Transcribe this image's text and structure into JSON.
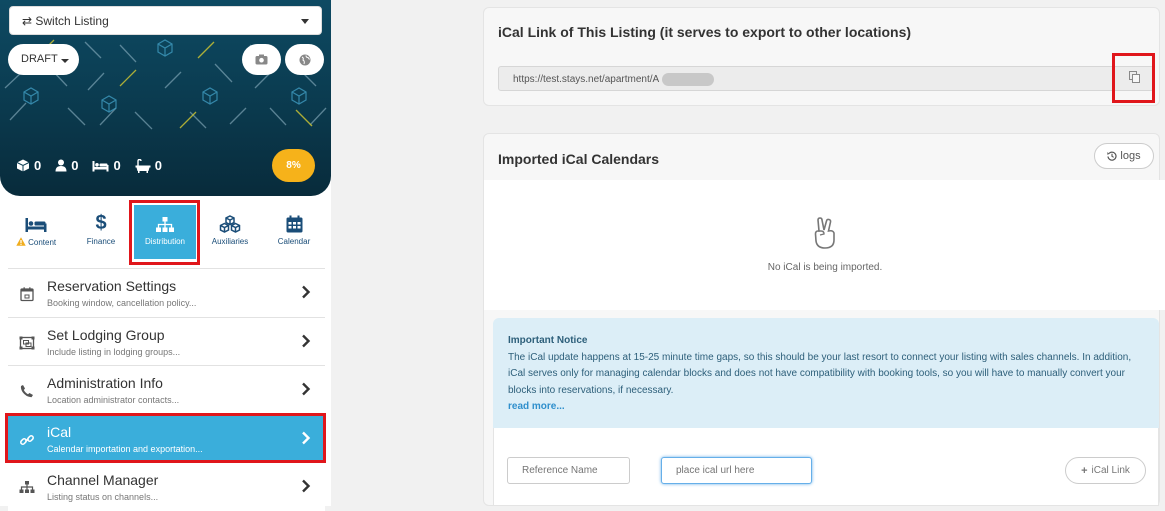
{
  "hero": {
    "switch_label": "⇄ Switch Listing",
    "status_label": "DRAFT",
    "stats": [
      {
        "icon": "cube-icon",
        "value": "0"
      },
      {
        "icon": "user-icon",
        "value": "0"
      },
      {
        "icon": "bed-icon",
        "value": "0"
      },
      {
        "icon": "bathtub-icon",
        "value": "0"
      }
    ],
    "completion": "8%"
  },
  "tabs": [
    {
      "label": "Content",
      "icon": "bed-icon",
      "warning": true
    },
    {
      "label": "Finance",
      "icon": "dollar-icon"
    },
    {
      "label": "Distribution",
      "icon": "sitemap-icon",
      "active": true
    },
    {
      "label": "Auxiliaries",
      "icon": "cubes-icon"
    },
    {
      "label": "Calendar",
      "icon": "calendar-icon"
    }
  ],
  "menu": [
    {
      "title": "Reservation Settings",
      "subtitle": "Booking window, cancellation policy...",
      "icon": "calendar-check-icon"
    },
    {
      "title": "Set Lodging Group",
      "subtitle": "Include listing in lodging groups...",
      "icon": "group-object-icon"
    },
    {
      "title": "Administration Info",
      "subtitle": "Location administrator contacts...",
      "icon": "phone-icon"
    },
    {
      "title": "iCal",
      "subtitle": "Calendar importation and exportation...",
      "icon": "link-icon",
      "active": true
    },
    {
      "title": "Channel Manager",
      "subtitle": "Listing status on channels...",
      "icon": "sitemap-icon"
    }
  ],
  "export_card": {
    "title": "iCal Link of This Listing (it serves to export to other locations)",
    "url": "https://test.stays.net/apartment/A"
  },
  "import_card": {
    "title": "Imported iCal Calendars",
    "logs_label": "logs",
    "empty_text": "No iCal is being imported.",
    "notice_title": "Important Notice",
    "notice_body": "The iCal update happens at 15-25 minute time gaps, so this should be your last resort to connect your listing with sales channels. In addition, iCal serves only for managing calendar blocks and does not have compatibility with booking tools, so you will have to manually convert your blocks into reservations, if necessary.",
    "read_more": "read more...",
    "reference_placeholder": "Reference Name",
    "url_placeholder": "place ical url here",
    "add_label": "iCal Link"
  },
  "colors": {
    "accent": "#3aaedb",
    "highlight": "#e0161b",
    "badge": "#f6b21a",
    "hero_bg": "#0e4a63"
  }
}
